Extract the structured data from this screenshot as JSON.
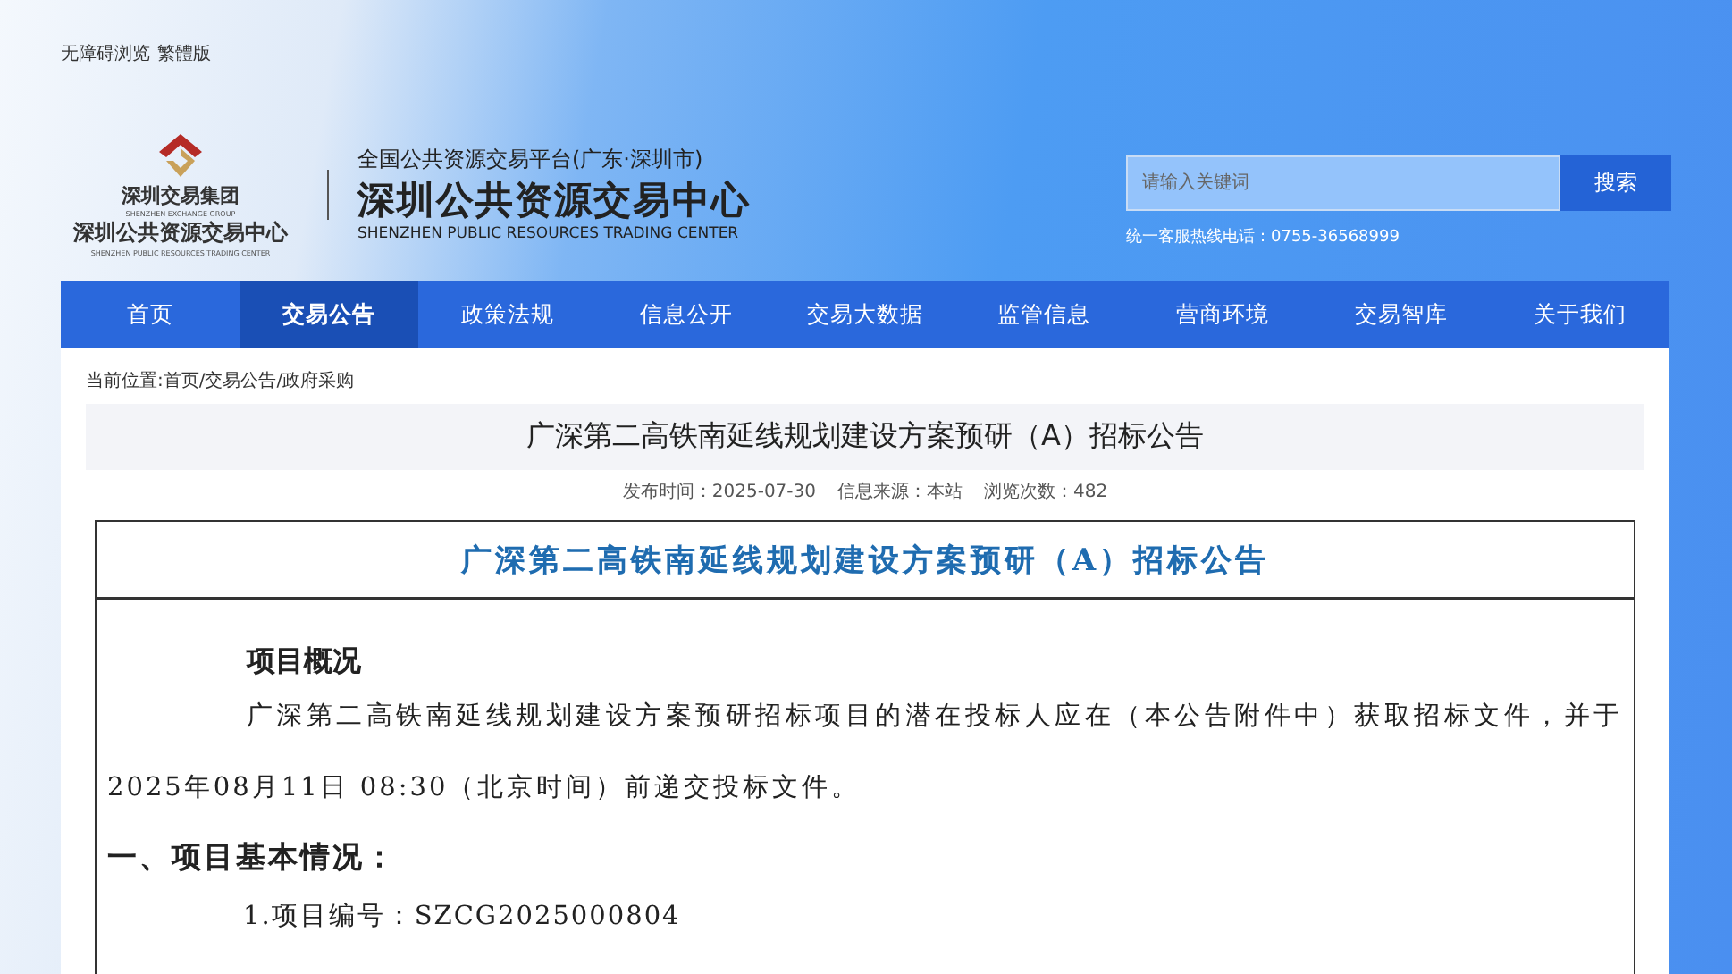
{
  "top_links": [
    "无障碍浏览",
    "繁體版"
  ],
  "logo": {
    "group_name": "深圳交易集团",
    "group_name_en": "SHENZHEN EXCHANGE GROUP",
    "center_name": "深圳公共资源交易中心",
    "center_name_en": "SHENZHEN PUBLIC RESOURCES TRADING CENTER"
  },
  "site": {
    "platform": "全国公共资源交易平台(广东·深圳市)",
    "name": "深圳公共资源交易中心",
    "name_en": "SHENZHEN PUBLIC RESOURCES TRADING CENTER"
  },
  "search": {
    "placeholder": "请输入关键词",
    "button": "搜索",
    "hotline": "统一客服热线电话：0755-36568999"
  },
  "nav": [
    {
      "label": "首页",
      "selected": false
    },
    {
      "label": "交易公告",
      "selected": true
    },
    {
      "label": "政策法规",
      "selected": false
    },
    {
      "label": "信息公开",
      "selected": false
    },
    {
      "label": "交易大数据",
      "selected": false
    },
    {
      "label": "监管信息",
      "selected": false
    },
    {
      "label": "营商环境",
      "selected": false
    },
    {
      "label": "交易智库",
      "selected": false
    },
    {
      "label": "关于我们",
      "selected": false
    }
  ],
  "breadcrumb": "当前位置:首页/交易公告/政府采购",
  "article": {
    "title": "广深第二高铁南延线规划建设方案预研（A）招标公告",
    "meta": [
      "发布时间：2025-07-30",
      "信息来源：本站",
      "浏览次数：482"
    ]
  },
  "document": {
    "title": "广深第二高铁南延线规划建设方案预研（A）招标公告",
    "overview_heading": "项目概况",
    "overview": "广深第二高铁南延线规划建设方案预研招标项目的潜在投标人应在（本公告附件中）获取招标文件，并于2025年08月11日 08:30（北京时间）前递交投标文件。",
    "section_heading": "一、项目基本情况：",
    "items": [
      "1.项目编号：SZCG2025000804"
    ]
  }
}
